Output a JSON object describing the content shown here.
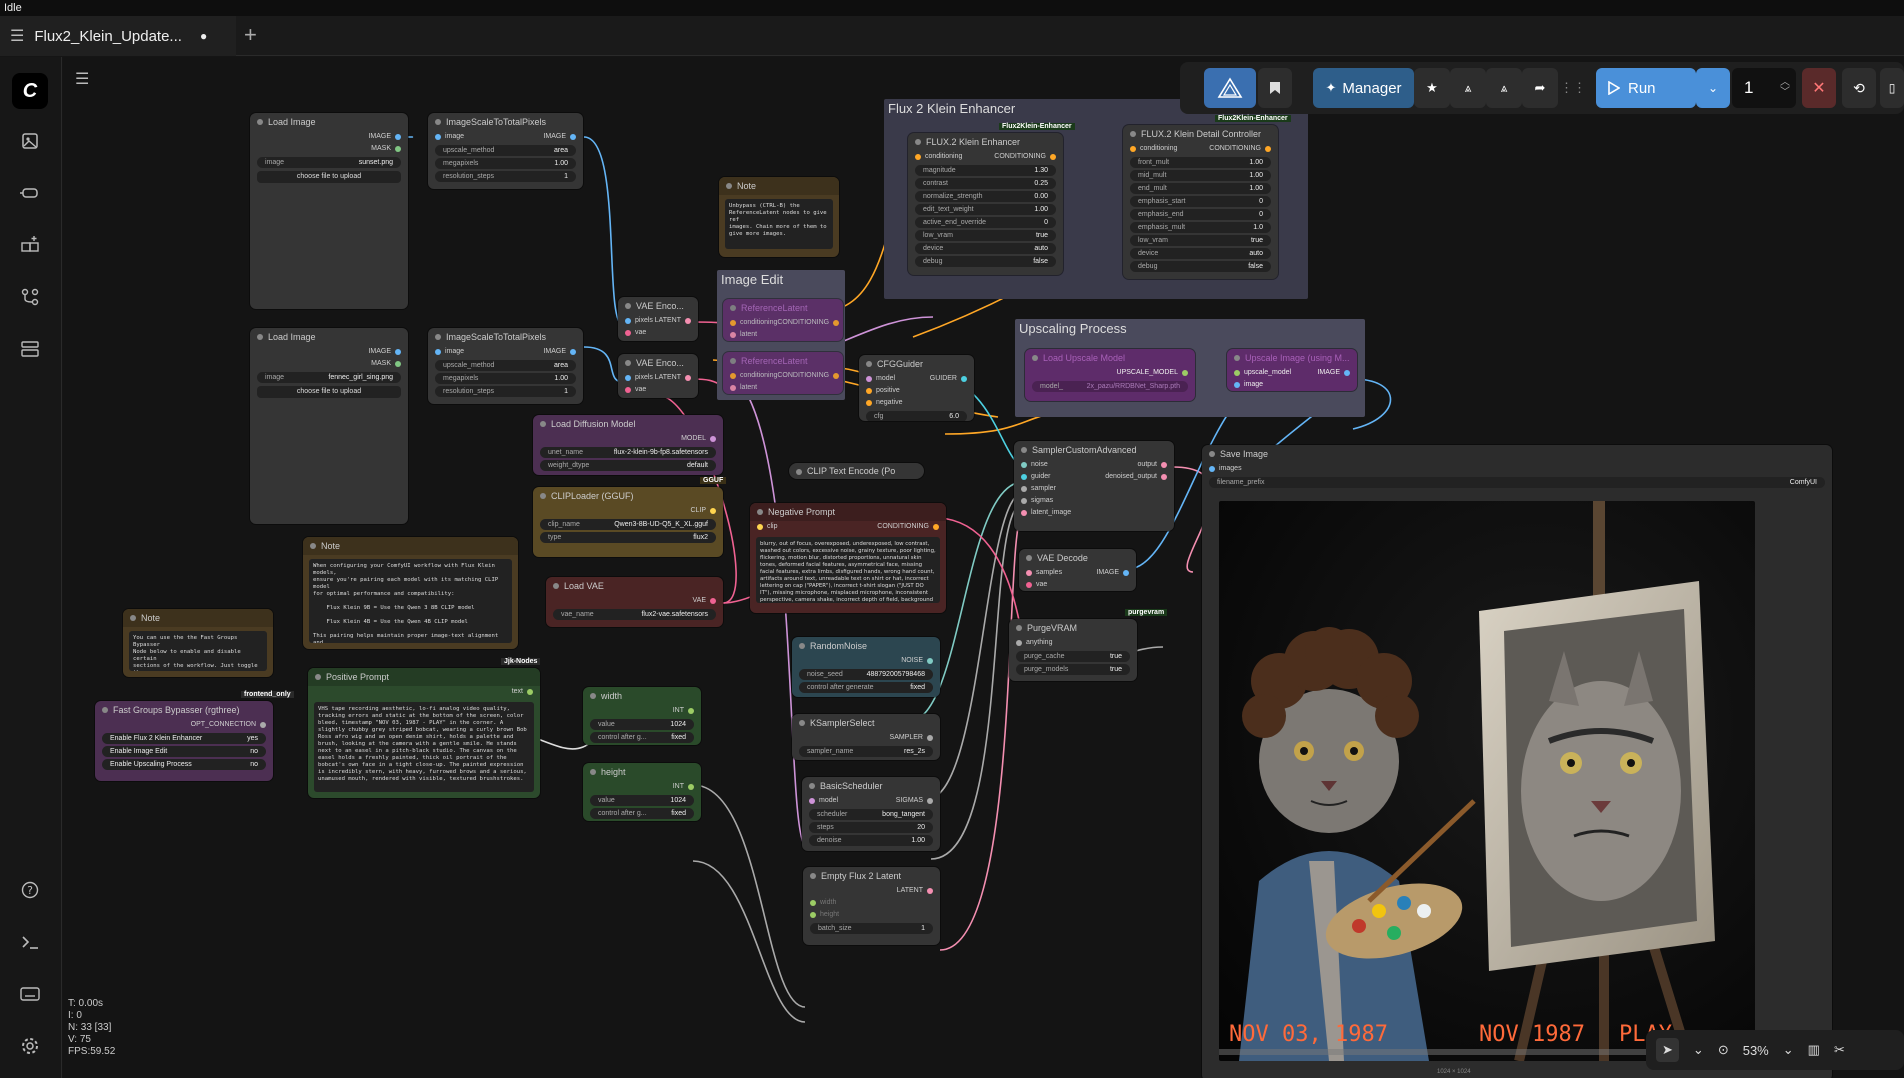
{
  "status": "Idle",
  "tab": {
    "title": "Flux2_Klein_Update...",
    "dot": "●",
    "plus": "+"
  },
  "sidebar": {
    "logo": "C",
    "items": [
      "images-icon",
      "models-icon",
      "nodes-icon",
      "workflows-icon",
      "templates-icon"
    ],
    "bottom": [
      "help-icon",
      "console-icon",
      "keyboard-icon",
      "settings-icon"
    ]
  },
  "toolbar": {
    "manager": "Manager",
    "run": "Run",
    "queue_count": "1"
  },
  "stats": [
    "T: 0.00s",
    "I: 0",
    "N: 33 [33]",
    "V: 75",
    "FPS:59.52"
  ],
  "zoom": "53%",
  "groups": {
    "enhancer": "Flux 2 Klein Enhancer",
    "image_edit": "Image Edit",
    "upscaling": "Upscaling Process"
  },
  "nodes": {
    "load_image_1": {
      "title": "Load Image",
      "out1": "IMAGE",
      "out2": "MASK",
      "image_label": "image",
      "image_value": "sunset.png",
      "upload": "choose file to upload"
    },
    "load_image_2": {
      "title": "Load Image",
      "out1": "IMAGE",
      "out2": "MASK",
      "image_label": "image",
      "image_value": "fennec_girl_sing.png",
      "upload": "choose file to upload"
    },
    "scale_1": {
      "title": "ImageScaleToTotalPixels",
      "in": "image",
      "out": "IMAGE",
      "w1": "upscale_method",
      "v1": "area",
      "w2": "megapixels",
      "v2": "1.00",
      "w3": "resolution_steps",
      "v3": "1"
    },
    "scale_2": {
      "title": "ImageScaleToTotalPixels",
      "in": "image",
      "out": "IMAGE",
      "w1": "upscale_method",
      "v1": "area",
      "w2": "megapixels",
      "v2": "1.00",
      "w3": "resolution_steps",
      "v3": "1"
    },
    "vae_enc_1": {
      "title": "VAE Enco...",
      "in1": "pixels",
      "in2": "vae",
      "out": "LATENT"
    },
    "vae_enc_2": {
      "title": "VAE Enco...",
      "in1": "pixels",
      "in2": "vae",
      "out": "LATENT"
    },
    "note_top": {
      "title": "Note",
      "text": "Unbypass (CTRL-B) the\nReferenceLatent nodes to give ref\nimages. Chain more of them to\ngive more images."
    },
    "ref_1": {
      "title": "ReferenceLatent",
      "in1": "conditioning",
      "in2": "latent",
      "out": "CONDITIONING"
    },
    "ref_2": {
      "title": "ReferenceLatent",
      "in1": "conditioning",
      "in2": "latent",
      "out": "CONDITIONING"
    },
    "enhancer": {
      "title": "FLUX.2 Klein Enhancer",
      "tag": "Flux2Klein-Enhancer",
      "in": "conditioning",
      "out": "CONDITIONING",
      "widgets": [
        [
          "magnitude",
          "1.30"
        ],
        [
          "contrast",
          "0.25"
        ],
        [
          "normalize_strength",
          "0.00"
        ],
        [
          "edit_text_weight",
          "1.00"
        ],
        [
          "active_end_override",
          "0"
        ],
        [
          "low_vram",
          "true"
        ],
        [
          "device",
          "auto"
        ],
        [
          "debug",
          "false"
        ]
      ]
    },
    "detail": {
      "title": "FLUX.2 Klein Detail Controller",
      "tag": "Flux2Klein-Enhancer",
      "in": "conditioning",
      "out": "CONDITIONING",
      "widgets": [
        [
          "front_mult",
          "1.00"
        ],
        [
          "mid_mult",
          "1.00"
        ],
        [
          "end_mult",
          "1.00"
        ],
        [
          "emphasis_start",
          "0"
        ],
        [
          "emphasis_end",
          "0"
        ],
        [
          "emphasis_mult",
          "1.0"
        ],
        [
          "low_vram",
          "true"
        ],
        [
          "device",
          "auto"
        ],
        [
          "debug",
          "false"
        ]
      ]
    },
    "cfg_guider": {
      "title": "CFGGuider",
      "in1": "model",
      "in2": "positive",
      "in3": "negative",
      "out": "GUIDER",
      "w": "cfg",
      "v": "6.0"
    },
    "upscale_loader": {
      "title": "Load Upscale Model",
      "out": "UPSCALE_MODEL",
      "w": "model_",
      "v": "2x_pazu/RRDBNet_Sharp.pth"
    },
    "upscale_image": {
      "title": "Upscale Image (using M...",
      "in1": "upscale_model",
      "in2": "image",
      "out": "IMAGE"
    },
    "load_diffusion": {
      "title": "Load Diffusion Model",
      "out": "MODEL",
      "w1": "unet_name",
      "v1": "flux-2-klein-9b-fp8.safetensors",
      "w2": "weight_dtype",
      "v2": "default"
    },
    "clip_loader": {
      "title": "CLIPLoader (GGUF)",
      "tag": "GGUF",
      "out": "CLIP",
      "w1": "clip_name",
      "v1": "Qwen3-8B-UD-Q5_K_XL.gguf",
      "w2": "type",
      "v2": "flux2"
    },
    "clip_text": {
      "title": "CLIP Text Encode (Po"
    },
    "negative": {
      "title": "Negative Prompt",
      "in": "clip",
      "out": "CONDITIONING",
      "text": "blurry, out of focus, overexposed, underexposed, low contrast, washed out colors, excessive noise, grainy texture, poor lighting, flickering, motion blur, distorted proportions, unnatural skin tones, deformed facial features, asymmetrical face, missing facial features, extra limbs, disfigured hands, wrong hand count, artifacts around text, unreadable text on shirt or hat, incorrect lettering on cap (\"PAPER\"), incorrect t-shirt slogan (\"JUST DO IT\"), missing microphone, misplaced microphone, inconsistent perspective, camera shake, incorrect depth of field, background too sharp, background clutter, distracting reflections, harsh shadows, inconsistent"
    },
    "sampler_adv": {
      "title": "SamplerCustomAdvanced",
      "ins": [
        "noise",
        "guider",
        "sampler",
        "sigmas",
        "latent_image"
      ],
      "out1": "output",
      "out2": "denoised_output"
    },
    "vae_decode": {
      "title": "VAE Decode",
      "in1": "samples",
      "in2": "vae",
      "out": "IMAGE"
    },
    "save_image": {
      "title": "Save Image",
      "in": "images",
      "w": "filename_prefix",
      "v": "ComfyUI",
      "dims": "1024 × 1024"
    },
    "purge": {
      "title": "PurgeVRAM",
      "tag": "purgevram",
      "in": "anything",
      "w1": "purge_cache",
      "v1": "true",
      "w2": "purge_models",
      "v2": "true"
    },
    "load_vae": {
      "title": "Load VAE",
      "out": "VAE",
      "w": "vae_name",
      "v": "flux2-vae.safetensors"
    },
    "note_mid": {
      "title": "Note",
      "text": "When configuring your ComfyUI workflow with Flux Klein models,\nensure you're pairing each model with its matching CLIP model\nfor optimal performance and compatibility:\n\n    Flux Klein 9B = Use the Qwen 3 8B CLIP model\n\n    Flux Klein 4B = Use the Qwen 4B CLIP model\n\nThis pairing helps maintain proper image-text alignment and\nproduces more consistent, high-quality results during\ngeneration."
    },
    "random_noise": {
      "title": "RandomNoise",
      "out": "NOISE",
      "w1": "noise_seed",
      "v1": "488792005798468",
      "w2": "control after generate",
      "v2": "fixed"
    },
    "ksampler_select": {
      "title": "KSamplerSelect",
      "out": "SAMPLER",
      "w": "sampler_name",
      "v": "res_2s"
    },
    "basic_sched": {
      "title": "BasicScheduler",
      "in": "model",
      "out": "SIGMAS",
      "w1": "scheduler",
      "v1": "bong_tangent",
      "w2": "steps",
      "v2": "20",
      "w3": "denoise",
      "v3": "1.00"
    },
    "empty_latent": {
      "title": "Empty Flux 2 Latent",
      "out": "LATENT",
      "w1": "width",
      "w2": "height",
      "w3": "batch_size",
      "v3": "1"
    },
    "width": {
      "title": "width",
      "out": "INT",
      "w1": "value",
      "v1": "1024",
      "w2": "control after g...",
      "v2": "fixed"
    },
    "height": {
      "title": "height",
      "out": "INT",
      "w1": "value",
      "v1": "1024",
      "w2": "control after g...",
      "v2": "fixed"
    },
    "note_left": {
      "title": "Note",
      "text": "You can use the the Fast Groups Bypasser\nNode below to enable and disable certain\nsections of the workflow. Just toggle the\nyes or no switch."
    },
    "bypasser": {
      "title": "Fast Groups Bypasser (rgthree)",
      "tag": "frontend_only",
      "out": "OPT_CONNECTION",
      "items": [
        [
          "Enable Flux 2 Klein Enhancer",
          "yes"
        ],
        [
          "Enable Image Edit",
          "no"
        ],
        [
          "Enable Upscaling Process",
          "no"
        ]
      ]
    },
    "positive": {
      "title": "Positive Prompt",
      "tag": "Jjk-Nodes",
      "out": "text",
      "text": "VHS tape recording aesthetic, lo-fi analog video quality, tracking errors and static at the bottom of the screen, color bleed, timestamp \"NOV 03, 1987 - PLAY\" in the corner. A slightly chubby grey striped bobcat, wearing a curly brown Bob Ross afro wig and an open denim shirt, holds a palette and brush, looking at the camera with a gentle smile. He stands next to an easel in a pitch-black studio. The canvas on the easel holds a freshly painted, thick oil portrait of the bobcat's own face in a tight close-up. The painted expression is incredibly stern, with heavy, furrowed brows and a serious, unamused mouth, rendered with visible, textured brushstrokes."
    }
  },
  "preview": {
    "stamp_left": "NOV 03, 1987",
    "stamp_right": "NOV 1987",
    "stamp_play": "PLAY"
  }
}
